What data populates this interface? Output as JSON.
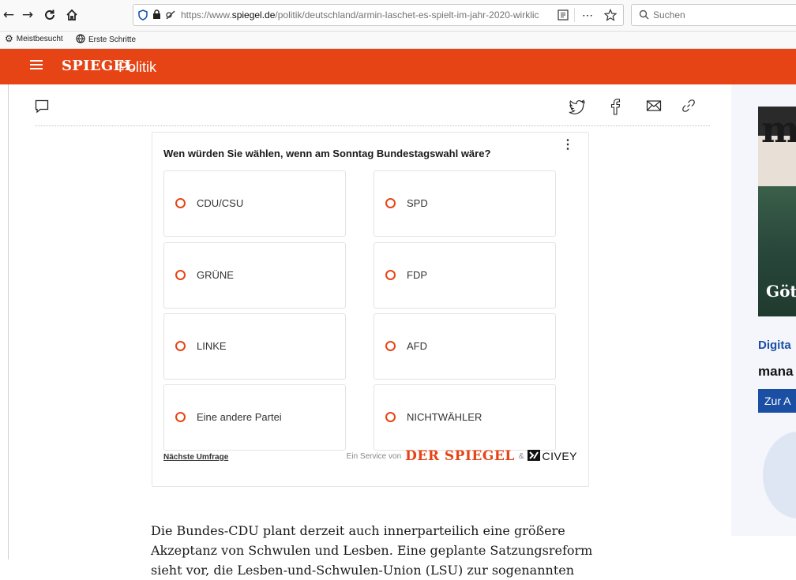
{
  "browser": {
    "url_prefix": "https://www.",
    "url_domain": "spiegel.de",
    "url_path": "/politik/deutschland/armin-laschet-es-spielt-im-jahr-2020-wirklic",
    "more_label": "⋯",
    "search_placeholder": "Suchen",
    "bookmarks": [
      "Meistbesucht",
      "Erste Schritte"
    ]
  },
  "site": {
    "logo": "SPIEGEL",
    "section": "Politik",
    "accent_color": "#e64415"
  },
  "poll": {
    "question": "Wen würden Sie wählen, wenn am Sonntag Bundestagswahl wäre?",
    "more": "⋮",
    "options": [
      "CDU/CSU",
      "SPD",
      "GRÜNE",
      "FDP",
      "LINKE",
      "AFD",
      "Eine andere Partei",
      "NICHTWÄHLER"
    ],
    "next_link": "Nächste Umfrage",
    "service_prefix": "Ein Service von",
    "service_brand": "DER SPIEGEL",
    "service_amp": "&",
    "partner": "CIVEY"
  },
  "article": {
    "line1": "Die Bundes-CDU plant derzeit auch innerparteilich eine größere",
    "line2": "Akzeptanz von Schwulen und Lesben. Eine geplante Satzungsreform",
    "line3": "sieht vor, die Lesben-und-Schwulen-Union (LSU) zur sogenannten"
  },
  "ad": {
    "title1": "Digita",
    "title2": "mana",
    "cta": "Zur A"
  }
}
